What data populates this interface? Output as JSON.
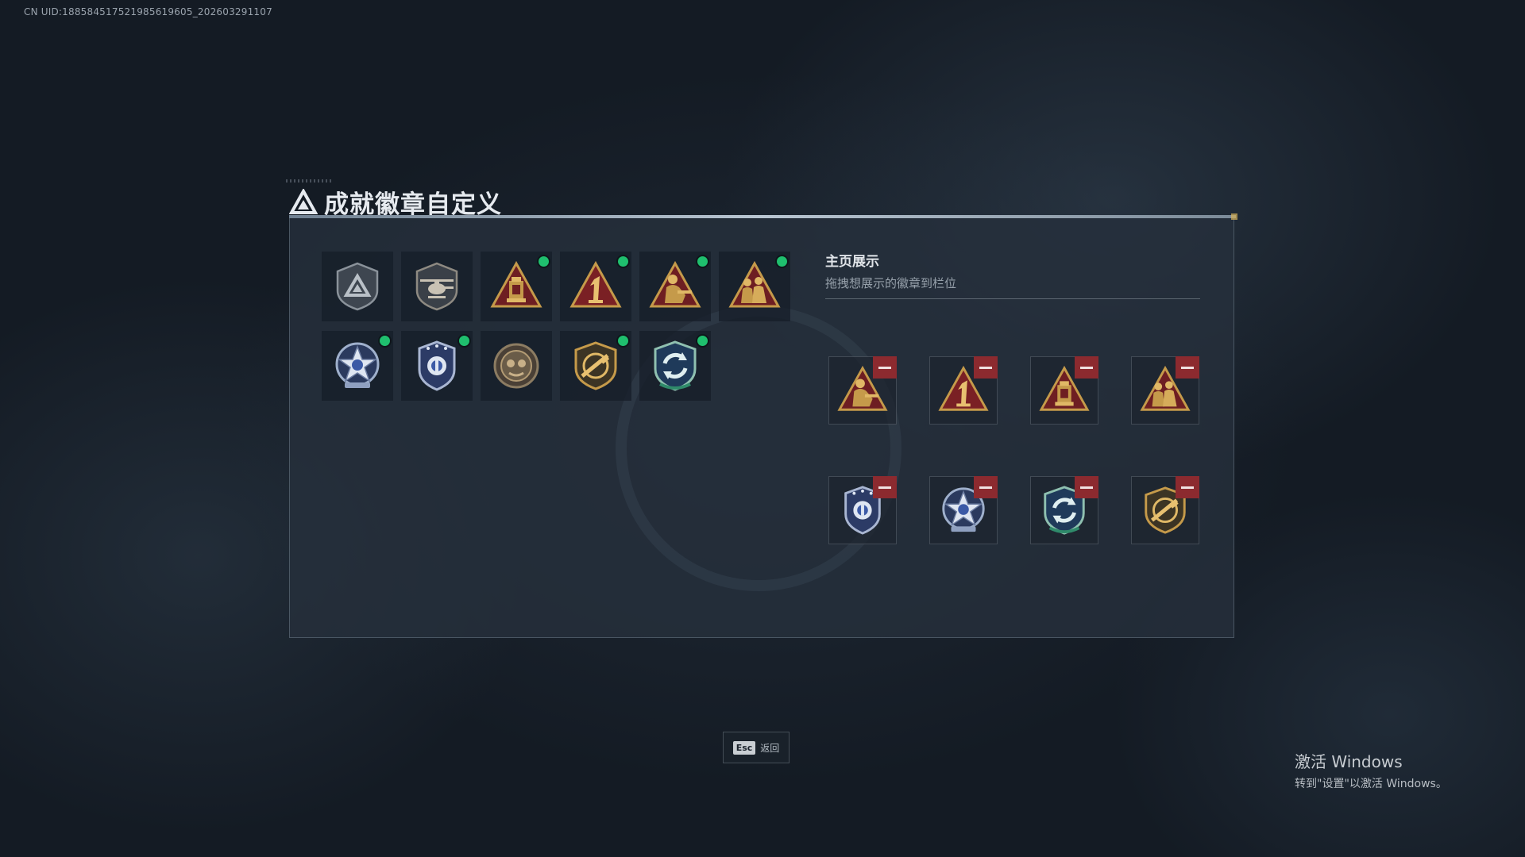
{
  "header": {
    "uid_text": "CN UID:188584517521985619605_202603291107",
    "title": "成就徽章自定义"
  },
  "inventory": {
    "badges": [
      {
        "icon": "gray-triangle-shield-badge-icon",
        "equipped": false
      },
      {
        "icon": "helicopter-shield-badge-icon",
        "equipped": false
      },
      {
        "icon": "gold-triangle-lantern-badge-icon",
        "equipped": true
      },
      {
        "icon": "gold-triangle-number-one-badge-icon",
        "equipped": true
      },
      {
        "icon": "gold-triangle-soldier-badge-icon",
        "equipped": true
      },
      {
        "icon": "gold-triangle-squad-badge-icon",
        "equipped": true
      },
      {
        "icon": "silver-star-badge-icon",
        "equipped": true
      },
      {
        "icon": "police-shield-badge-icon",
        "equipped": true
      },
      {
        "icon": "bronze-circle-badge-icon",
        "equipped": false
      },
      {
        "icon": "rifle-shield-badge-icon",
        "equipped": true
      },
      {
        "icon": "green-cycle-shield-badge-icon",
        "equipped": true
      }
    ]
  },
  "showcase": {
    "title": "主页展示",
    "subtitle": "拖拽想展示的徽章到栏位",
    "slots": [
      {
        "icon": "gold-triangle-soldier-badge-icon"
      },
      {
        "icon": "gold-triangle-number-one-badge-icon"
      },
      {
        "icon": "gold-triangle-lantern-badge-icon"
      },
      {
        "icon": "gold-triangle-squad-badge-icon"
      },
      {
        "icon": "police-shield-badge-icon"
      },
      {
        "icon": "silver-star-badge-icon"
      },
      {
        "icon": "green-cycle-shield-badge-icon"
      },
      {
        "icon": "rifle-shield-badge-icon"
      }
    ]
  },
  "footer": {
    "esc_key": "Esc",
    "esc_label": "返回"
  },
  "watermark": {
    "title": "激活 Windows",
    "subtitle": "转到\"设置\"以激活 Windows。"
  },
  "colors": {
    "equipped_dot": "#1fbf6e",
    "remove_button": "#8c2a2f",
    "gold": "#c59a4a",
    "crimson": "#7a2024"
  }
}
